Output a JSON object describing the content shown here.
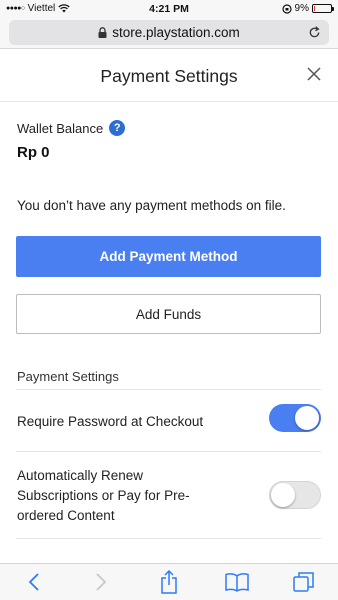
{
  "status_bar": {
    "carrier": "Viettel",
    "time": "4:21 PM",
    "battery_percent": "9%",
    "battery_level": 0.09
  },
  "browser": {
    "url": "store.playstation.com"
  },
  "modal": {
    "title": "Payment Settings",
    "wallet_label": "Wallet Balance",
    "help_glyph": "?",
    "balance": "Rp 0",
    "no_methods_text": "You don’t have any payment methods on file.",
    "add_payment_label": "Add Payment Method",
    "add_funds_label": "Add Funds",
    "section_title": "Payment Settings",
    "settings": [
      {
        "label": "Require Password at Checkout",
        "enabled": true
      },
      {
        "label": "Automatically Renew Subscriptions or Pay for Pre-ordered Content",
        "enabled": false
      }
    ]
  },
  "toolbar": {
    "icons": [
      "back-icon",
      "forward-icon",
      "share-icon",
      "bookmarks-icon",
      "tabs-icon"
    ]
  },
  "colors": {
    "accent": "#4a7ff2",
    "help_icon": "#2d6fd1",
    "toolbar_icon": "#2f7cf6"
  }
}
